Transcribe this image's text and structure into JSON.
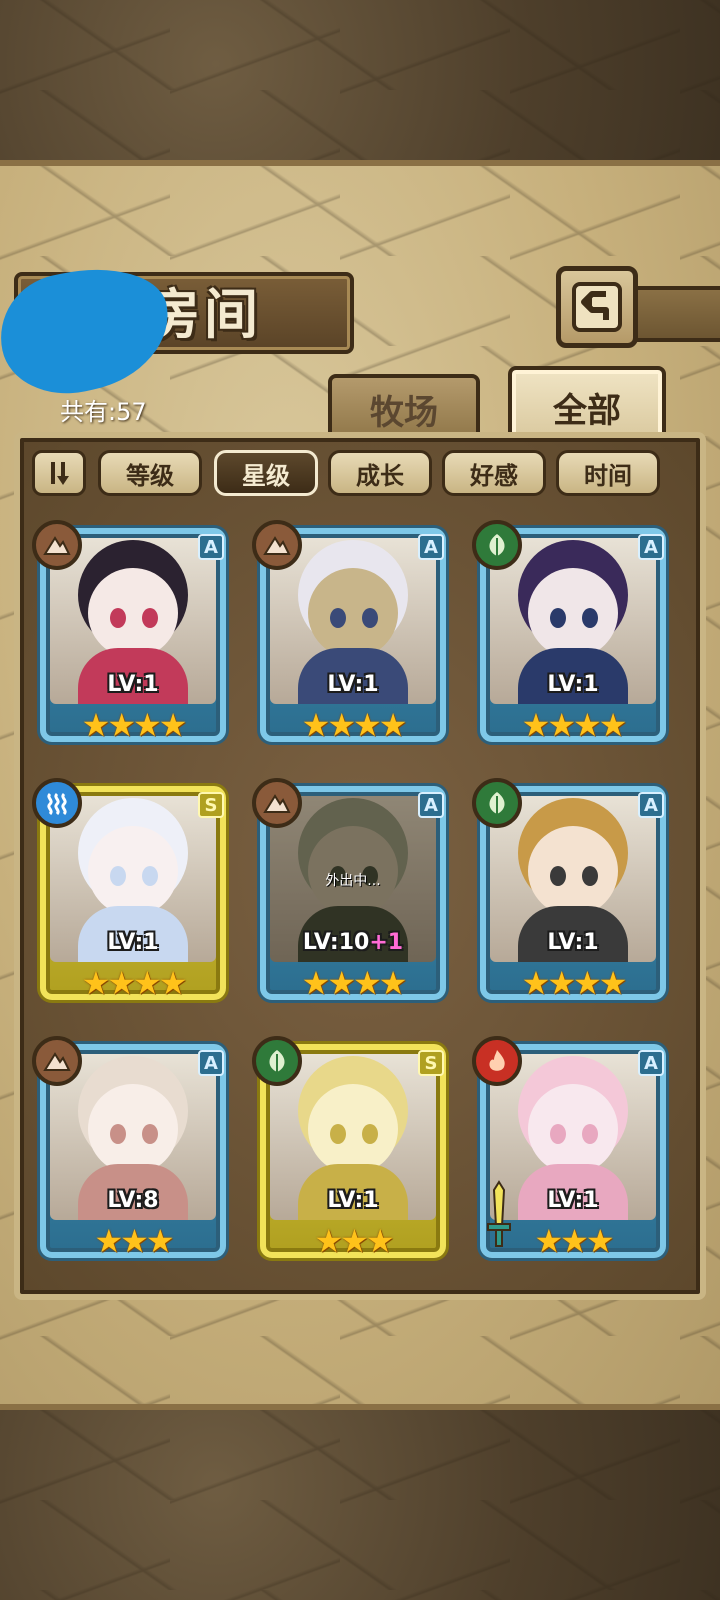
{
  "header": {
    "title": "魔物房间",
    "count_label": "共有:57"
  },
  "tabs": [
    {
      "label": "牧场",
      "active": false
    },
    {
      "label": "全部",
      "active": true
    }
  ],
  "sort_buttons": [
    {
      "label": "等级",
      "active": false
    },
    {
      "label": "星级",
      "active": true
    },
    {
      "label": "成长",
      "active": false
    },
    {
      "label": "好感",
      "active": false
    },
    {
      "label": "时间",
      "active": false
    }
  ],
  "cards": [
    {
      "element": "earth",
      "element_icon": "mountain-icon",
      "rank": "A",
      "level": "LV:1",
      "plus": "",
      "stars": "★★★★",
      "status": "",
      "frame": "blue",
      "palette": [
        "#2b2230",
        "#f5e9e6",
        "#c23a5a"
      ]
    },
    {
      "element": "earth",
      "element_icon": "mountain-icon",
      "rank": "A",
      "level": "LV:1",
      "plus": "",
      "stars": "★★★★",
      "status": "",
      "frame": "blue",
      "palette": [
        "#e8e6ee",
        "#c8b58a",
        "#3a4a78"
      ]
    },
    {
      "element": "grass",
      "element_icon": "leaf-icon",
      "rank": "A",
      "level": "LV:1",
      "plus": "",
      "stars": "★★★★",
      "status": "",
      "frame": "blue",
      "palette": [
        "#3a2a5a",
        "#f0e6e8",
        "#2a3a6a"
      ]
    },
    {
      "element": "water",
      "element_icon": "water-icon",
      "rank": "S",
      "level": "LV:1",
      "plus": "",
      "stars": "★★★★",
      "status": "",
      "frame": "gold",
      "palette": [
        "#eef0f8",
        "#f8f0f0",
        "#c8d8f0"
      ]
    },
    {
      "element": "earth",
      "element_icon": "mountain-icon",
      "rank": "A",
      "level": "LV:10",
      "plus": "+1",
      "stars": "★★★★",
      "status": "外出中...",
      "frame": "blue",
      "palette": [
        "#9aa88a",
        "#c8c0a8",
        "#4a5a3a"
      ]
    },
    {
      "element": "grass",
      "element_icon": "leaf-icon",
      "rank": "A",
      "level": "LV:1",
      "plus": "",
      "stars": "★★★★",
      "status": "",
      "frame": "blue",
      "palette": [
        "#c89a48",
        "#f4e2d0",
        "#3a3a3a"
      ]
    },
    {
      "element": "earth",
      "element_icon": "mountain-icon",
      "rank": "A",
      "level": "LV:8",
      "plus": "",
      "stars": "★★★",
      "status": "",
      "frame": "blue",
      "palette": [
        "#e8dcd0",
        "#f8eee8",
        "#c89088"
      ]
    },
    {
      "element": "grass",
      "element_icon": "leaf-icon",
      "rank": "S",
      "level": "LV:1",
      "plus": "",
      "stars": "★★★",
      "status": "",
      "frame": "gold",
      "palette": [
        "#e8d88a",
        "#f8f0c8",
        "#c8b048"
      ]
    },
    {
      "element": "fire",
      "element_icon": "flame-icon",
      "rank": "A",
      "level": "LV:1",
      "plus": "",
      "stars": "★★★",
      "status": "",
      "frame": "blue",
      "palette": [
        "#f4c8d8",
        "#f8e8ee",
        "#e8a8c0"
      ]
    }
  ]
}
